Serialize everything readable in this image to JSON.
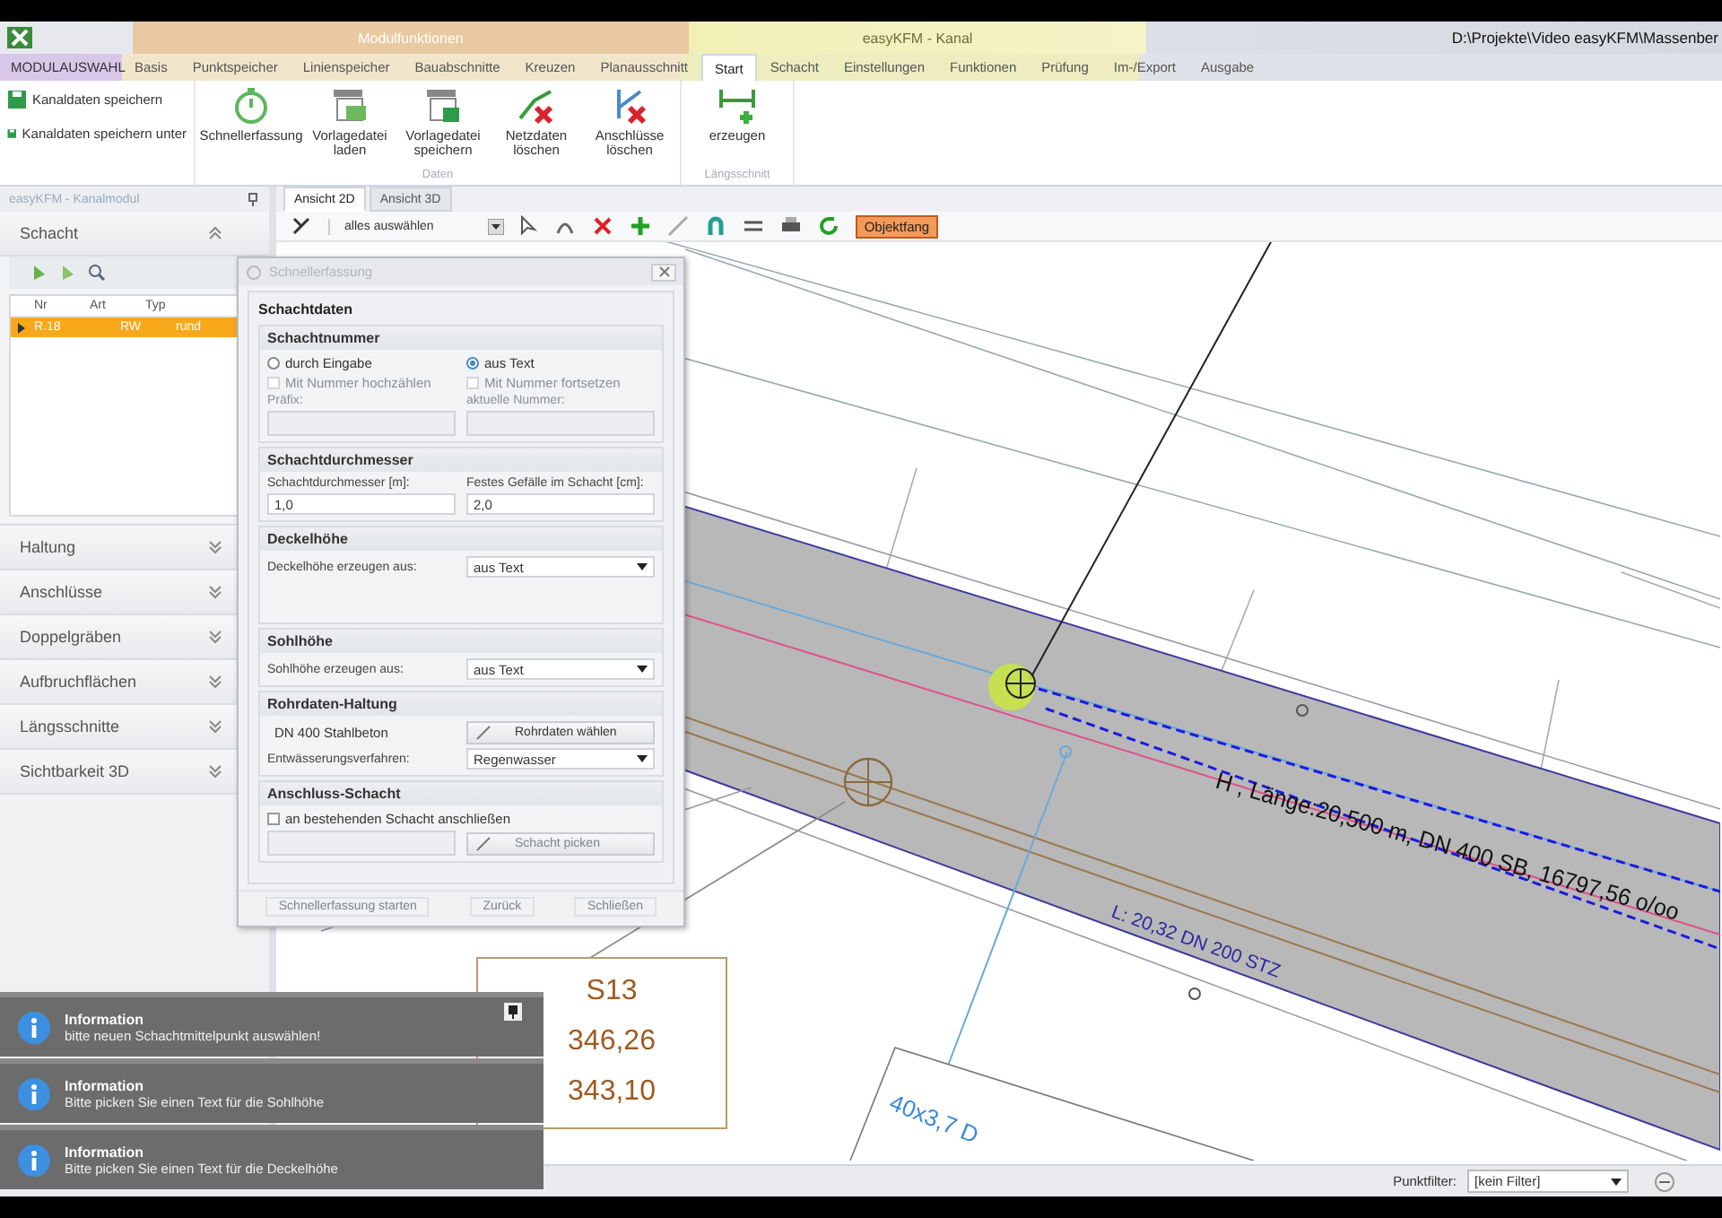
{
  "ribbon": {
    "context_groups": [
      {
        "label": "Modulfunktionen",
        "kind": "module"
      },
      {
        "label": "easyKFM - Kanal",
        "kind": "channel"
      }
    ],
    "file_path": "D:\\Projekte\\Video easyKFM\\Massenber",
    "app_menu": "MODULAUSWAHL",
    "tabs": [
      {
        "label": "Basis",
        "selected": false
      },
      {
        "label": "Punktspeicher",
        "selected": false
      },
      {
        "label": "Linienspeicher",
        "selected": false
      },
      {
        "label": "Bauabschnitte",
        "selected": false
      },
      {
        "label": "Kreuzen",
        "selected": false
      },
      {
        "label": "Planausschnitt",
        "selected": false
      },
      {
        "label": "Start",
        "selected": true
      },
      {
        "label": "Schacht",
        "selected": false
      },
      {
        "label": "Einstellungen",
        "selected": false
      },
      {
        "label": "Funktionen",
        "selected": false
      },
      {
        "label": "Prüfung",
        "selected": false
      },
      {
        "label": "Im-/Export",
        "selected": false
      },
      {
        "label": "Ausgabe",
        "selected": false
      }
    ],
    "quick_commands": [
      "Kanaldaten speichern",
      "Kanaldaten speichern unter"
    ],
    "groups": [
      {
        "caption": "Daten",
        "buttons": [
          {
            "label": "Schnellerfassung",
            "kind": "stopwatch"
          },
          {
            "label": "Vorlagedatei laden",
            "kind": "load"
          },
          {
            "label": "Vorlagedatei speichern",
            "kind": "save"
          },
          {
            "label": "Netzdaten löschen",
            "kind": "netdelete"
          },
          {
            "label": "Anschlüsse löschen",
            "kind": "linkdelete"
          }
        ]
      },
      {
        "caption": "Längsschnitt",
        "buttons": [
          {
            "label": "erzeugen",
            "kind": "profile"
          }
        ]
      }
    ]
  },
  "left_panel": {
    "title": "easyKFM - Kanalmodul",
    "sections": [
      {
        "label": "Schacht",
        "expanded": true
      },
      {
        "label": "Haltung",
        "expanded": false
      },
      {
        "label": "Anschlüsse",
        "expanded": false
      },
      {
        "label": "Doppelgräben",
        "expanded": false
      },
      {
        "label": "Aufbruchflächen",
        "expanded": false
      },
      {
        "label": "Längsschnitte",
        "expanded": false
      },
      {
        "label": "Sichtbarkeit 3D",
        "expanded": false
      }
    ],
    "table": {
      "columns": [
        "Nr",
        "Art",
        "Typ"
      ],
      "rows": [
        {
          "cells": [
            "R.18",
            "RW",
            "rund"
          ],
          "selected": true
        }
      ]
    }
  },
  "view_tabs": [
    {
      "label": "Ansicht 2D",
      "selected": true
    },
    {
      "label": "Ansicht 3D",
      "selected": false
    }
  ],
  "toolbar": {
    "selection_mode": "alles auswählen",
    "snap_button": {
      "label": "Objektfang",
      "active": true
    }
  },
  "drawing": {
    "pipe_label": "H , Länge:20,500 m, DN 400 SB, 16797,56 o/oo",
    "connection_label": "L: 20,32 DN 200 STZ",
    "shaft_label": [
      "S13",
      "346,26",
      "343,10"
    ],
    "area_label": "40x3,7 D"
  },
  "dialog": {
    "title": "Schnellerfassung",
    "group": "Schachtdaten",
    "sections": [
      {
        "title": "Schachtnummer",
        "items": [
          {
            "kind": "radio",
            "label": "durch Eingabe",
            "selected": false
          },
          {
            "kind": "radio",
            "label": "aus Text",
            "selected": true
          },
          {
            "kind": "checkbox",
            "label": "Mit Nummer hochzählen",
            "checked": false,
            "disabled": true
          },
          {
            "kind": "checkbox",
            "label": "Mit Nummer fortsetzen",
            "checked": false,
            "disabled": true
          },
          {
            "kind": "label",
            "label": "Präfix:",
            "disabled": true
          },
          {
            "kind": "label",
            "label": "aktuelle Nummer:",
            "disabled": true
          },
          {
            "kind": "field",
            "disabled": true
          },
          {
            "kind": "field",
            "disabled": true
          }
        ]
      },
      {
        "title": "Schachtdurchmesser",
        "items": [
          {
            "kind": "label",
            "label": "Schachtdurchmesser [m]:"
          },
          {
            "kind": "label",
            "label": "Festes Gefälle im Schacht [cm]:"
          },
          {
            "kind": "field",
            "value": "1,0"
          },
          {
            "kind": "field",
            "value": "2,0"
          }
        ]
      },
      {
        "title": "Deckelhöhe",
        "items": [
          {
            "kind": "label",
            "label": "Deckelhöhe erzeugen aus:"
          },
          {
            "kind": "select",
            "value": "aus Text"
          }
        ]
      },
      {
        "title": "Sohlhöhe",
        "items": [
          {
            "kind": "label",
            "label": "Sohlhöhe erzeugen aus:"
          },
          {
            "kind": "select",
            "value": "aus Text"
          }
        ]
      },
      {
        "title": "Rohrdaten-Haltung",
        "items": [
          {
            "kind": "field",
            "value": "DN 400 Stahlbeton"
          },
          {
            "kind": "button",
            "label": "Rohrdaten wählen"
          },
          {
            "kind": "label",
            "label": "Entwässerungsverfahren:"
          },
          {
            "kind": "select",
            "value": "Regenwasser"
          }
        ]
      },
      {
        "title": "Anschluss-Schacht",
        "items": [
          {
            "kind": "checkbox",
            "label": "an bestehenden Schacht anschließen",
            "checked": false
          },
          {
            "kind": "field",
            "disabled": true
          },
          {
            "kind": "button",
            "label": "Schacht picken",
            "disabled": true
          }
        ]
      }
    ],
    "footer_buttons": [
      {
        "label": "Schnellerfassung starten",
        "disabled": true
      },
      {
        "label": "Zurück",
        "disabled": true
      },
      {
        "label": "Schließen",
        "disabled": true
      }
    ]
  },
  "notifications": [
    {
      "title": "Information",
      "message": "bitte neuen Schachtmittelpunkt auswählen!",
      "pinned": true
    },
    {
      "title": "Information",
      "message": "Bitte picken Sie einen Text für die Sohlhöhe",
      "pinned": false
    },
    {
      "title": "Information",
      "message": "Bitte picken Sie einen Text für die Deckelhöhe",
      "pinned": false
    }
  ],
  "status_bar": {
    "filter_label": "Punktfilter:",
    "filter_value": "[kein Filter]"
  }
}
